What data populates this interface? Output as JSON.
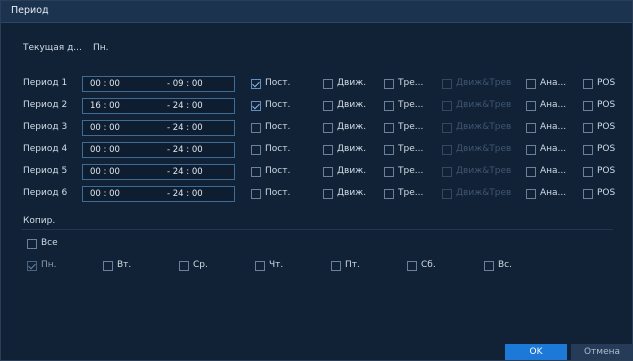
{
  "dialog": {
    "title": "Период"
  },
  "current_day": {
    "label": "Текущая д...",
    "value": "Пн."
  },
  "periods": [
    {
      "label": "Период 1",
      "start": "00 : 00",
      "end": "- 09 : 00",
      "checks": [
        true,
        false,
        false,
        false,
        false,
        false
      ]
    },
    {
      "label": "Период 2",
      "start": "16 : 00",
      "end": "- 24 : 00",
      "checks": [
        true,
        false,
        false,
        false,
        false,
        false
      ]
    },
    {
      "label": "Период 3",
      "start": "00 : 00",
      "end": "- 24 : 00",
      "checks": [
        false,
        false,
        false,
        false,
        false,
        false
      ]
    },
    {
      "label": "Период 4",
      "start": "00 : 00",
      "end": "- 24 : 00",
      "checks": [
        false,
        false,
        false,
        false,
        false,
        false
      ]
    },
    {
      "label": "Период 5",
      "start": "00 : 00",
      "end": "- 24 : 00",
      "checks": [
        false,
        false,
        false,
        false,
        false,
        false
      ]
    },
    {
      "label": "Период 6",
      "start": "00 : 00",
      "end": "- 24 : 00",
      "checks": [
        false,
        false,
        false,
        false,
        false,
        false
      ]
    }
  ],
  "record_types": [
    "Пост.",
    "Движ.",
    "Тре...",
    "Движ&Трев",
    "Ана...",
    "POS"
  ],
  "record_types_disabled": [
    false,
    false,
    false,
    true,
    false,
    false
  ],
  "copy": {
    "label": "Копир.",
    "all_label": "Все",
    "days": [
      "Пн.",
      "Вт.",
      "Ср.",
      "Чт.",
      "Пт.",
      "Сб.",
      "Вс."
    ]
  },
  "buttons": {
    "ok": "OK",
    "cancel": "Отмена"
  },
  "colors": {
    "accent": "#1c79d8",
    "background": "#112236",
    "titlebar": "#1c3350"
  }
}
